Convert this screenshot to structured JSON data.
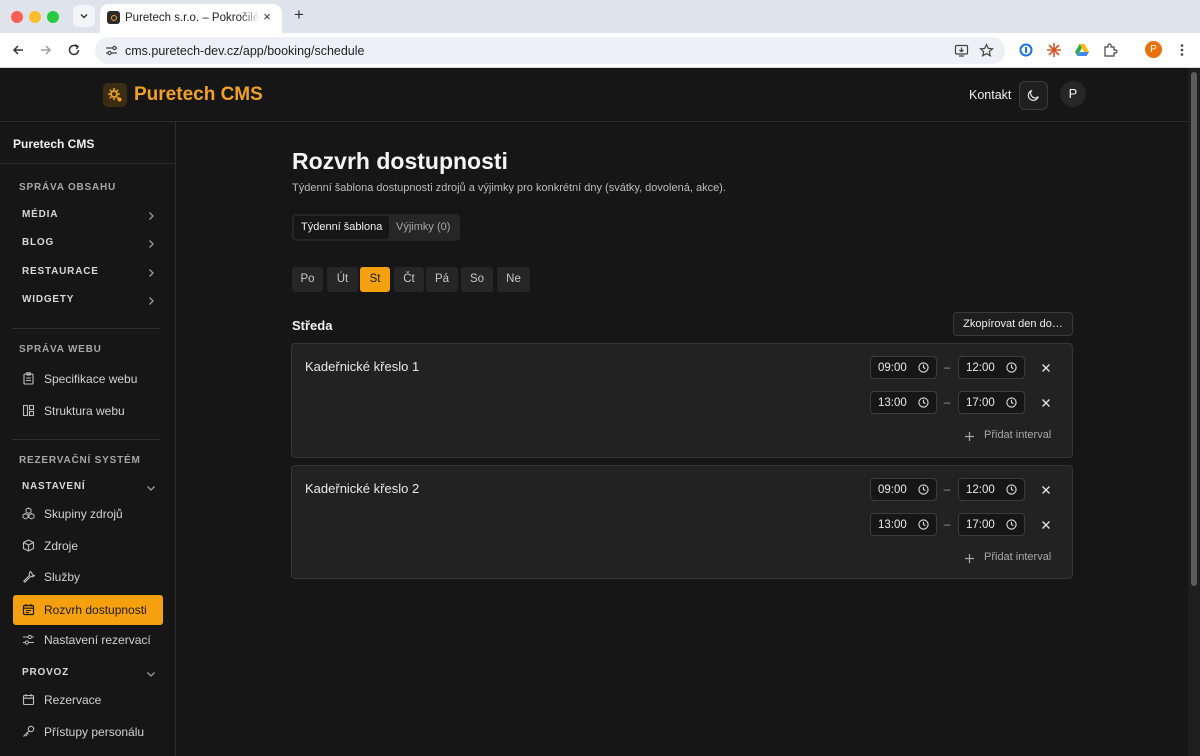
{
  "browser": {
    "tab_title": "Puretech s.r.o. – Pokročilé webové stránky",
    "url": "cms.puretech-dev.cz/app/booking/schedule",
    "profile_initial": "P"
  },
  "header": {
    "brand": "Puretech CMS",
    "contact": "Kontakt",
    "user_initial": "P",
    "accent": "#f5a00f"
  },
  "sidebar": {
    "title": "Puretech CMS",
    "content_section": "SPRÁVA OBSAHU",
    "content_groups": [
      {
        "label": "MÉDIA"
      },
      {
        "label": "BLOG"
      },
      {
        "label": "RESTAURACE"
      },
      {
        "label": "WIDGETY"
      }
    ],
    "web_section": "SPRÁVA WEBU",
    "web_items": [
      {
        "label": "Specifikace webu",
        "icon": "clipboard-icon"
      },
      {
        "label": "Struktura webu",
        "icon": "layout-icon"
      }
    ],
    "booking_section": "REZERVAČNÍ SYSTÉM",
    "settings_group": "NASTAVENÍ",
    "settings_items": [
      {
        "label": "Skupiny zdrojů",
        "icon": "boxes-icon"
      },
      {
        "label": "Zdroje",
        "icon": "box-icon"
      },
      {
        "label": "Služby",
        "icon": "wrench-icon"
      },
      {
        "label": "Rozvrh dostupnosti",
        "icon": "calendar-icon",
        "active": true
      },
      {
        "label": "Nastavení rezervací",
        "icon": "sliders-icon"
      }
    ],
    "operations_group": "PROVOZ",
    "operations_items": [
      {
        "label": "Rezervace",
        "icon": "calendar-icon"
      },
      {
        "label": "Přístupy personálu",
        "icon": "key-icon"
      }
    ]
  },
  "main": {
    "title": "Rozvrh dostupnosti",
    "subtitle": "Týdenní šablona dostupnosti zdrojů a výjimky pro konkrétní dny (svátky, dovolená, akce).",
    "tabs": [
      {
        "label": "Týdenní šablona",
        "active": true
      },
      {
        "label": "Výjimky (0)",
        "active": false
      }
    ],
    "days": [
      {
        "label": "Po"
      },
      {
        "label": "Út"
      },
      {
        "label": "St",
        "active": true
      },
      {
        "label": "Čt"
      },
      {
        "label": "Pá"
      },
      {
        "label": "So"
      },
      {
        "label": "Ne"
      }
    ],
    "day_title": "Středa",
    "copy_day_label": "Zkopírovat den do…",
    "resources": [
      {
        "name": "Kadeřnické křeslo 1",
        "intervals": [
          {
            "from": "09:00",
            "to": "12:00"
          },
          {
            "from": "13:00",
            "to": "17:00"
          }
        ]
      },
      {
        "name": "Kadeřnické křeslo 2",
        "intervals": [
          {
            "from": "09:00",
            "to": "12:00"
          },
          {
            "from": "13:00",
            "to": "17:00"
          }
        ]
      }
    ],
    "add_interval_label": "Přidat interval",
    "dash": "–"
  }
}
